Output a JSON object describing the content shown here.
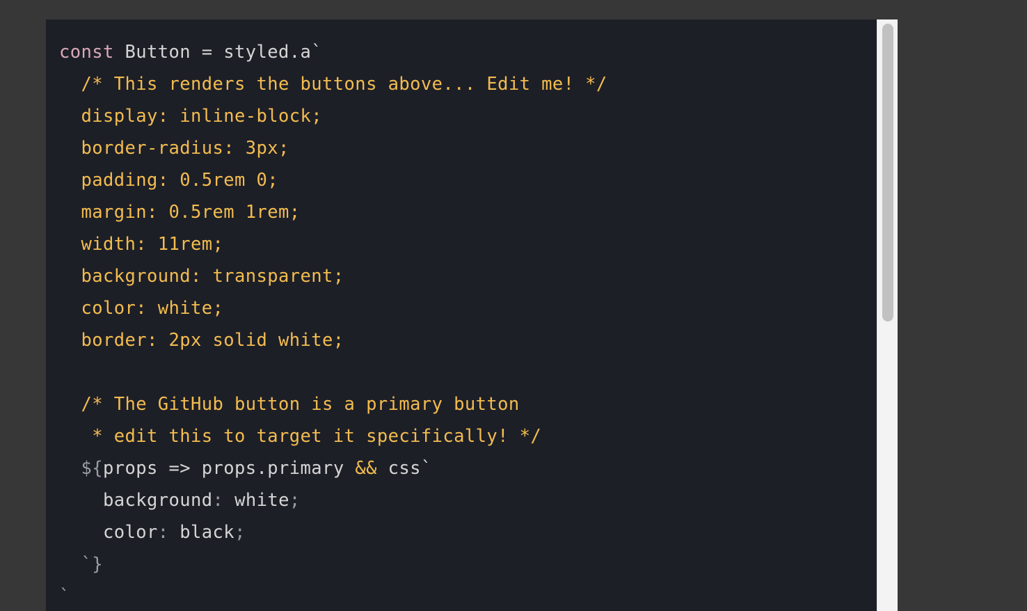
{
  "editor": {
    "lines": [
      [
        {
          "t": "const",
          "c": "kw"
        },
        {
          "t": " Button = styled.a`",
          "c": "plain"
        }
      ],
      [
        {
          "t": "  /* This renders the buttons above... Edit me! */",
          "c": "str"
        }
      ],
      [
        {
          "t": "  display: inline-block;",
          "c": "str"
        }
      ],
      [
        {
          "t": "  border-radius: 3px;",
          "c": "str"
        }
      ],
      [
        {
          "t": "  padding: 0.5rem 0;",
          "c": "str"
        }
      ],
      [
        {
          "t": "  margin: 0.5rem 1rem;",
          "c": "str"
        }
      ],
      [
        {
          "t": "  width: 11rem;",
          "c": "str"
        }
      ],
      [
        {
          "t": "  background: transparent;",
          "c": "str"
        }
      ],
      [
        {
          "t": "  color: white;",
          "c": "str"
        }
      ],
      [
        {
          "t": "  border: 2px solid white;",
          "c": "str"
        }
      ],
      [
        {
          "t": "",
          "c": "str"
        }
      ],
      [
        {
          "t": "  /* The GitHub button is a primary button",
          "c": "str"
        }
      ],
      [
        {
          "t": "   * edit this to target it specifically! */",
          "c": "str"
        }
      ],
      [
        {
          "t": "  ${",
          "c": "punc"
        },
        {
          "t": "props => props.primary ",
          "c": "plain"
        },
        {
          "t": "&&",
          "c": "str"
        },
        {
          "t": " css`",
          "c": "plain"
        }
      ],
      [
        {
          "t": "    background",
          "c": "prop"
        },
        {
          "t": ":",
          "c": "punc"
        },
        {
          "t": " white",
          "c": "plain"
        },
        {
          "t": ";",
          "c": "punc"
        }
      ],
      [
        {
          "t": "    color",
          "c": "prop"
        },
        {
          "t": ":",
          "c": "punc"
        },
        {
          "t": " black",
          "c": "plain"
        },
        {
          "t": ";",
          "c": "punc"
        }
      ],
      [
        {
          "t": "  `}",
          "c": "punc"
        }
      ],
      [
        {
          "t": "`",
          "c": "punc"
        }
      ]
    ]
  },
  "colors": {
    "background": "#1d1f27",
    "keyword": "#d8a9b7",
    "string": "#f3bc4f",
    "plain": "#d5d5d5",
    "punctuation": "#9a9ca3"
  }
}
